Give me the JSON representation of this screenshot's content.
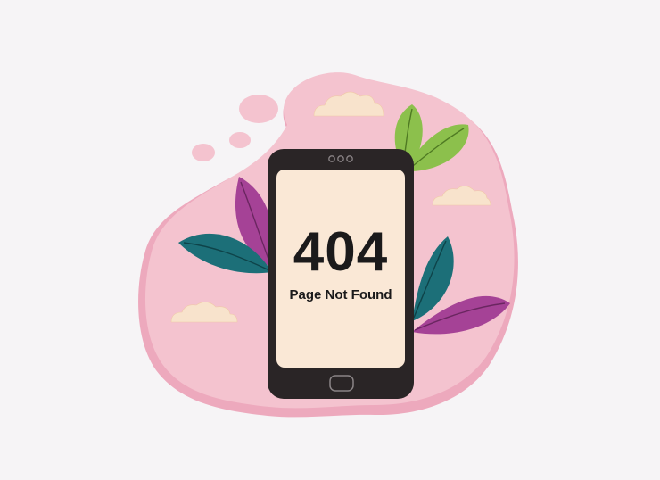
{
  "error": {
    "code": "404",
    "message": "Page Not Found"
  },
  "colors": {
    "background": "#f6f4f6",
    "blob": "#f4c3cf",
    "blob_shadow": "#eda9bd",
    "phone_body": "#2a2526",
    "phone_screen": "#fae8d6",
    "cloud": "#f8e3cc",
    "leaf_green": "#8cc04c",
    "leaf_teal": "#1c6f78",
    "leaf_purple": "#a54296",
    "text": "#1b1a1b"
  },
  "icons": [
    "cloud-icon",
    "leaf-icon",
    "smartphone-icon",
    "home-button-icon",
    "camera-dots-icon"
  ]
}
